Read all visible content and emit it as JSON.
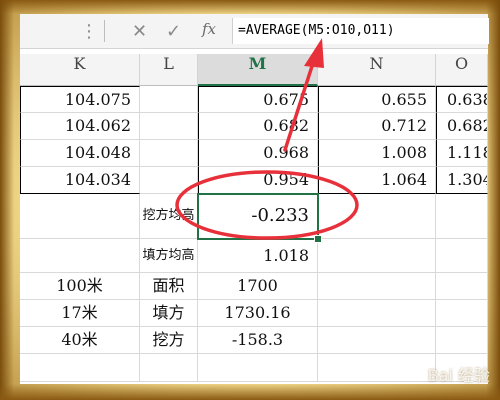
{
  "formula_bar": {
    "cancel_icon": "close-icon",
    "confirm_icon": "check-icon",
    "fx_label": "fx",
    "formula": "=AVERAGE(M5:O10,O11)"
  },
  "columns": [
    "K",
    "L",
    "M",
    "N",
    "O"
  ],
  "rows": [
    {
      "K": "104.075",
      "L": "",
      "M": "0.675",
      "N": "0.655",
      "O": "0.638"
    },
    {
      "K": "104.062",
      "L": "",
      "M": "0.682",
      "N": "0.712",
      "O": "0.682"
    },
    {
      "K": "104.048",
      "L": "",
      "M": "0.968",
      "N": "1.008",
      "O": "1.118"
    },
    {
      "K": "104.034",
      "L": "",
      "M": "0.954",
      "N": "1.064",
      "O": "1.304"
    },
    {
      "K": "",
      "L": "挖方均高",
      "M": "-0.233",
      "N": "",
      "O": ""
    },
    {
      "K": "",
      "L": "填方均高",
      "M": "1.018",
      "N": "",
      "O": ""
    },
    {
      "K": "100米",
      "L": "面积",
      "M": "1700",
      "N": "",
      "O": ""
    },
    {
      "K": "17米",
      "L": "填方",
      "M": "1730.16",
      "N": "",
      "O": ""
    },
    {
      "K": "40米",
      "L": "挖方",
      "M": "-158.3",
      "N": "",
      "O": ""
    },
    {
      "K": "",
      "L": "",
      "M": "",
      "N": "",
      "O": ""
    }
  ],
  "annotation_colors": {
    "circle": "#e8303a",
    "arrow": "#e8303a"
  },
  "watermark": "Bai 经验"
}
